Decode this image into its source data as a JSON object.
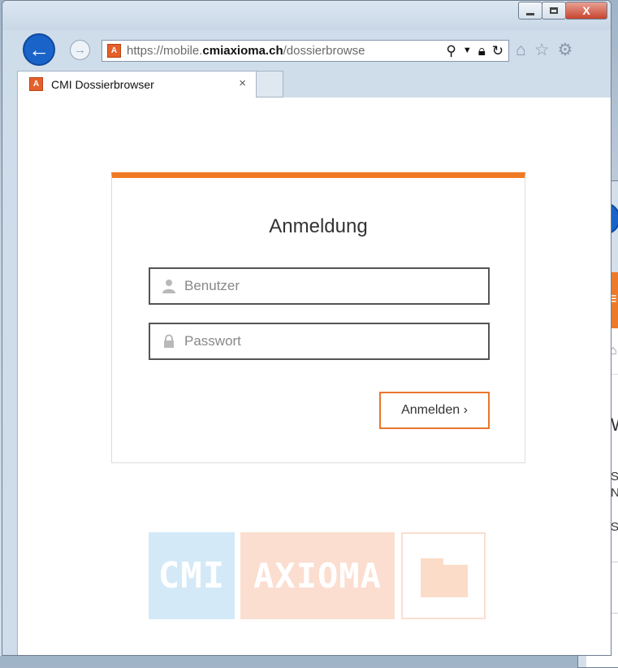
{
  "browser": {
    "url_prefix": "https://mobile.",
    "url_domain": "cmiaxioma.ch",
    "url_path": "/dossierbrowse",
    "favicon_letter": "A",
    "tab_title": "CMI Dossierbrowser",
    "tab_close": "×",
    "window_close": "X"
  },
  "login": {
    "title": "Anmeldung",
    "username_placeholder": "Benutzer",
    "username_value": "",
    "password_placeholder": "Passwort",
    "password_value": "",
    "submit_label": "Anmelden ›"
  },
  "logo": {
    "part1": "CMI",
    "part2": "AXIOMA"
  },
  "background_window": {
    "heading_fragment": "W",
    "line1": "S",
    "line2": "N",
    "line3": "S"
  },
  "colors": {
    "accent": "#f07a24",
    "ie_blue": "#1a63c9"
  }
}
